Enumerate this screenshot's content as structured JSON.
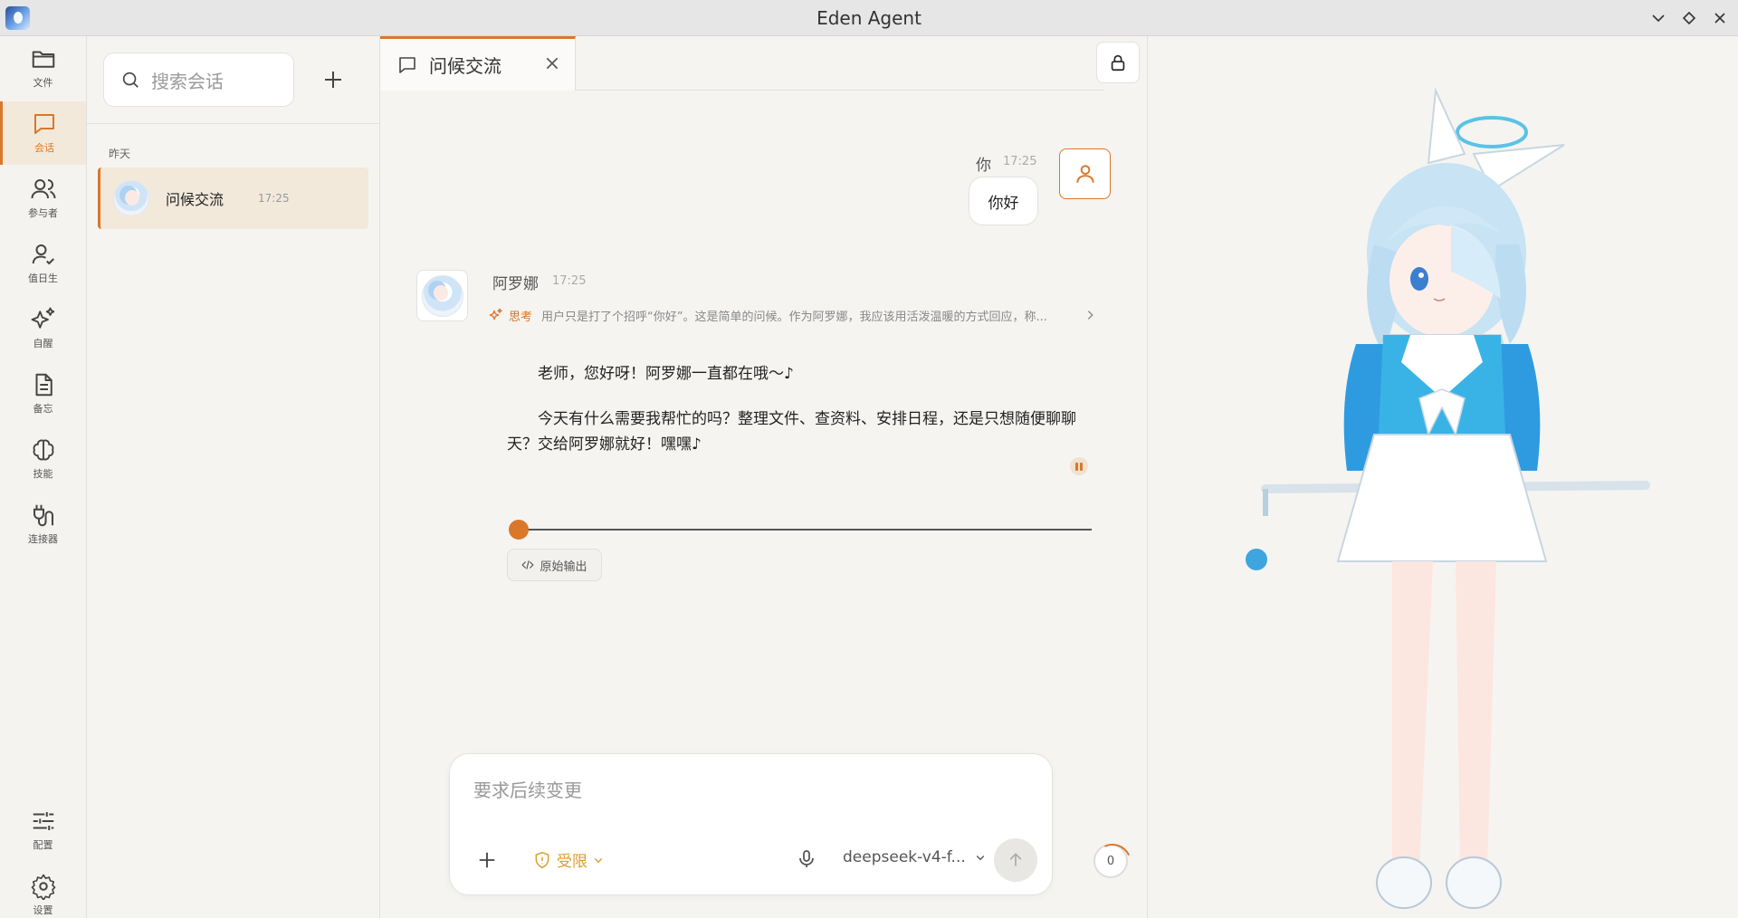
{
  "window": {
    "title": "Eden Agent"
  },
  "rail": {
    "items": [
      {
        "label": "文件",
        "icon": "folder-icon"
      },
      {
        "label": "会话",
        "icon": "chat-icon"
      },
      {
        "label": "参与者",
        "icon": "users-icon"
      },
      {
        "label": "值日生",
        "icon": "user-check-icon"
      },
      {
        "label": "自醒",
        "icon": "sparkles-icon"
      },
      {
        "label": "备忘",
        "icon": "document-icon"
      },
      {
        "label": "技能",
        "icon": "brain-icon"
      },
      {
        "label": "连接器",
        "icon": "plug-icon"
      },
      {
        "label": "配置",
        "icon": "sliders-icon"
      },
      {
        "label": "设置",
        "icon": "gear-icon"
      }
    ],
    "active_index": 1
  },
  "sidebar": {
    "search_placeholder": "搜索会话",
    "group_label": "昨天",
    "conversations": [
      {
        "name": "问候交流",
        "time": "17:25"
      }
    ]
  },
  "tabs": [
    {
      "label": "问候交流"
    }
  ],
  "messages": {
    "user": {
      "name": "你",
      "time": "17:25",
      "text": "你好"
    },
    "bot": {
      "name": "阿罗娜",
      "time": "17:25",
      "think_label": "思考",
      "think_text": "用户只是打了个招呼“你好”。这是简单的问候。作为阿罗娜，我应该用活泼温暖的方式回应，称...",
      "paragraphs": [
        "老师，您好呀！阿罗娜一直都在哦～♪",
        "今天有什么需要我帮忙的吗？整理文件、查资料、安排日程，还是只想随便聊聊天？交给阿罗娜就好！嘿嘿♪"
      ],
      "audio_progress": 0.0,
      "raw_output_label": "原始输出"
    }
  },
  "composer": {
    "placeholder": "要求后续变更",
    "permission_label": "受限",
    "model_label": "deepseek-v4-f...",
    "context_count": "0"
  },
  "colors": {
    "accent": "#d9772b",
    "permission": "#d9a02b"
  }
}
